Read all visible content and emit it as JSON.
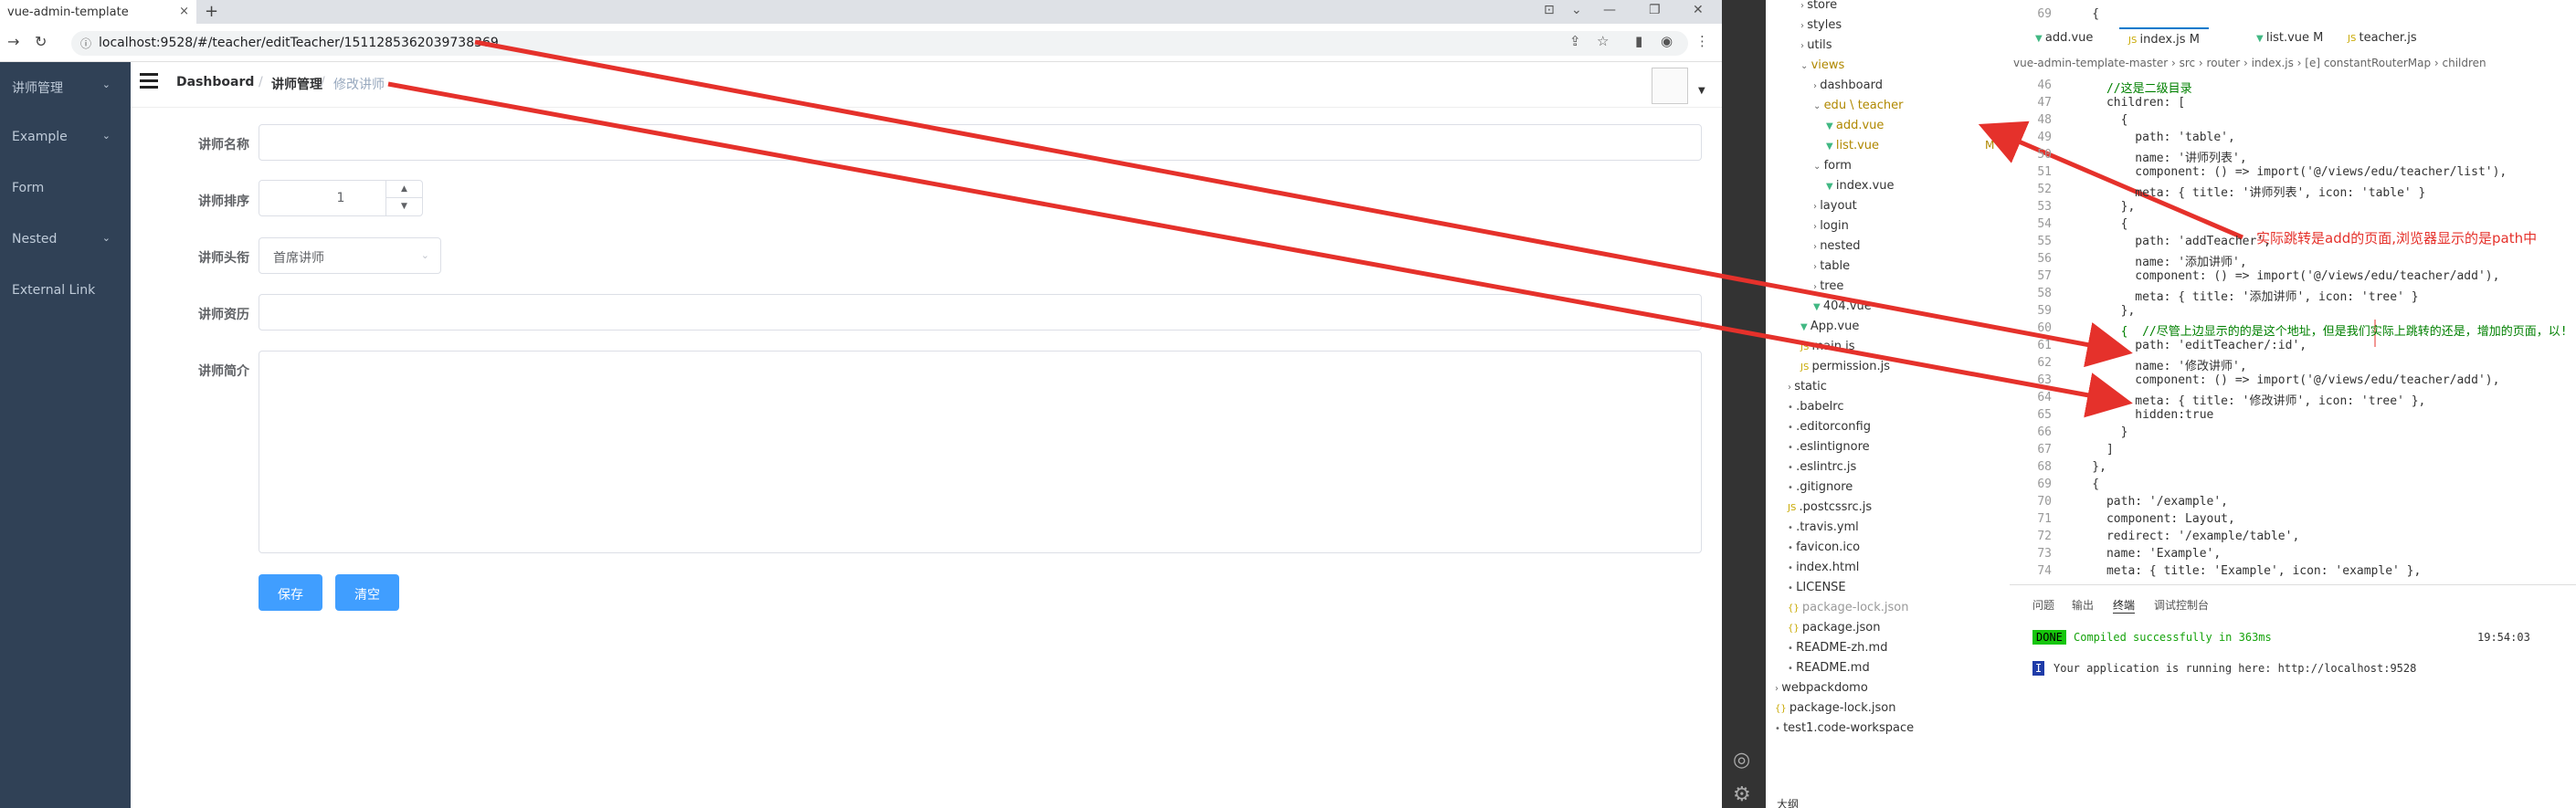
{
  "browser": {
    "tab_title": "vue-admin-template",
    "tab_close": "×",
    "new_tab": "+",
    "url": "localhost:9528/#/teacher/editTeacher/1511285362039738369",
    "window_min": "—",
    "window_max": "❐",
    "window_close": "✕"
  },
  "sidebar": {
    "items": [
      {
        "label": "讲师管理",
        "has_arrow": true
      },
      {
        "label": "Example",
        "has_arrow": true
      },
      {
        "label": "Form",
        "has_arrow": false
      },
      {
        "label": "Nested",
        "has_arrow": true
      },
      {
        "label": "External Link",
        "has_arrow": false
      }
    ],
    "bg_color": "#304156",
    "text_color": "#bfcbd9"
  },
  "breadcrumb": {
    "items": [
      "Dashboard",
      "讲师管理",
      "修改讲师"
    ],
    "separator": "/"
  },
  "form": {
    "labels": {
      "name": "讲师名称",
      "sort": "讲师排序",
      "level": "讲师头衔",
      "career": "讲师资历",
      "intro": "讲师简介"
    },
    "sort_value": "1",
    "level_value": "首席讲师",
    "save_label": "保存",
    "clear_label": "清空",
    "button_color": "#409eff"
  },
  "vscode": {
    "tree": [
      {
        "label": "store",
        "indent": 2,
        "type": "folder"
      },
      {
        "label": "styles",
        "indent": 2,
        "type": "folder"
      },
      {
        "label": "utils",
        "indent": 2,
        "type": "folder"
      },
      {
        "label": "views",
        "indent": 2,
        "type": "folder-open",
        "color": "#b08800"
      },
      {
        "label": "dashboard",
        "indent": 3,
        "type": "folder"
      },
      {
        "label": "edu \\ teacher",
        "indent": 3,
        "type": "folder-open",
        "color": "#b08800"
      },
      {
        "label": "add.vue",
        "indent": 4,
        "type": "vue",
        "color": "#b08800"
      },
      {
        "label": "list.vue",
        "indent": 4,
        "type": "vue",
        "color": "#b08800",
        "badge": "M"
      },
      {
        "label": "form",
        "indent": 3,
        "type": "folder-open"
      },
      {
        "label": "index.vue",
        "indent": 4,
        "type": "vue"
      },
      {
        "label": "layout",
        "indent": 3,
        "type": "folder"
      },
      {
        "label": "login",
        "indent": 3,
        "type": "folder"
      },
      {
        "label": "nested",
        "indent": 3,
        "type": "folder"
      },
      {
        "label": "table",
        "indent": 3,
        "type": "folder"
      },
      {
        "label": "tree",
        "indent": 3,
        "type": "folder"
      },
      {
        "label": "404.vue",
        "indent": 3,
        "type": "vue"
      },
      {
        "label": "App.vue",
        "indent": 2,
        "type": "vue"
      },
      {
        "label": "main.js",
        "indent": 2,
        "type": "js"
      },
      {
        "label": "permission.js",
        "indent": 2,
        "type": "js"
      },
      {
        "label": "static",
        "indent": 1,
        "type": "folder"
      },
      {
        "label": ".babelrc",
        "indent": 1,
        "type": "file"
      },
      {
        "label": ".editorconfig",
        "indent": 1,
        "type": "file"
      },
      {
        "label": ".eslintignore",
        "indent": 1,
        "type": "file"
      },
      {
        "label": ".eslintrc.js",
        "indent": 1,
        "type": "file"
      },
      {
        "label": ".gitignore",
        "indent": 1,
        "type": "file"
      },
      {
        "label": ".postcssrc.js",
        "indent": 1,
        "type": "js"
      },
      {
        "label": ".travis.yml",
        "indent": 1,
        "type": "file"
      },
      {
        "label": "favicon.ico",
        "indent": 1,
        "type": "file"
      },
      {
        "label": "index.html",
        "indent": 1,
        "type": "file"
      },
      {
        "label": "LICENSE",
        "indent": 1,
        "type": "file"
      },
      {
        "label": "package-lock.json",
        "indent": 1,
        "type": "json",
        "color": "#999"
      },
      {
        "label": "package.json",
        "indent": 1,
        "type": "json"
      },
      {
        "label": "README-zh.md",
        "indent": 1,
        "type": "file"
      },
      {
        "label": "README.md",
        "indent": 1,
        "type": "file"
      },
      {
        "label": "webpackdomo",
        "indent": 0,
        "type": "folder"
      },
      {
        "label": "package-lock.json",
        "indent": 0,
        "type": "json"
      },
      {
        "label": "test1.code-workspace",
        "indent": 0,
        "type": "file"
      }
    ],
    "tabs": [
      {
        "label": "add.vue",
        "badge": ""
      },
      {
        "label": "index.js",
        "badge": "M",
        "active": true
      },
      {
        "label": "list.vue",
        "badge": "M"
      },
      {
        "label": "teacher.js",
        "badge": ""
      }
    ],
    "breadcrumb": "vue-admin-template-master › src › router › index.js › [e] constantRouterMap › children",
    "code": [
      {
        "n": "46",
        "t": "      //这是二级目录"
      },
      {
        "n": "47",
        "t": "      children: ["
      },
      {
        "n": "48",
        "t": "        {"
      },
      {
        "n": "49",
        "t": "          path: 'table',"
      },
      {
        "n": "50",
        "t": "          name: '讲师列表',"
      },
      {
        "n": "51",
        "t": "          component: () => import('@/views/edu/teacher/list'),"
      },
      {
        "n": "52",
        "t": "          meta: { title: '讲师列表', icon: 'table' }"
      },
      {
        "n": "53",
        "t": "        },"
      },
      {
        "n": "54",
        "t": "        {"
      },
      {
        "n": "55",
        "t": "          path: 'addTeacher',"
      },
      {
        "n": "56",
        "t": "          name: '添加讲师',"
      },
      {
        "n": "57",
        "t": "          component: () => import('@/views/edu/teacher/add'),"
      },
      {
        "n": "58",
        "t": "          meta: { title: '添加讲师', icon: 'tree' }"
      },
      {
        "n": "59",
        "t": "        },"
      },
      {
        "n": "60",
        "t": "        {  //尽管上边显示的的是这个地址，但是我们实际上跳转的还是，增加的页面，以!"
      },
      {
        "n": "61",
        "t": "          path: 'editTeacher/:id',"
      },
      {
        "n": "62",
        "t": "          name: '修改讲师',"
      },
      {
        "n": "63",
        "t": "          component: () => import('@/views/edu/teacher/add'),"
      },
      {
        "n": "64",
        "t": "          meta: { title: '修改讲师', icon: 'tree' },"
      },
      {
        "n": "65",
        "t": "          hidden:true"
      },
      {
        "n": "66",
        "t": "        }"
      },
      {
        "n": "67",
        "t": "      ]"
      },
      {
        "n": "68",
        "t": "    },"
      },
      {
        "n": "69",
        "t": "    {"
      },
      {
        "n": "70",
        "t": "      path: '/example',"
      },
      {
        "n": "71",
        "t": "      component: Layout,"
      },
      {
        "n": "72",
        "t": "      redirect: '/example/table',"
      },
      {
        "n": "73",
        "t": "      name: 'Example',"
      },
      {
        "n": "74",
        "t": "      meta: { title: 'Example', icon: 'example' },"
      }
    ],
    "top_lines": [
      {
        "n": "69",
        "t": "    {"
      }
    ],
    "note": "实际跳转是add的页面,浏览器显示的是path中",
    "panel": {
      "tabs": [
        "问题",
        "输出",
        "终端",
        "调试控制台"
      ],
      "done_badge": "DONE",
      "compiled": "Compiled successfully in 363ms",
      "time": "19:54:03",
      "running": "Your application is running here: http://localhost:9528"
    },
    "status_label": "大纲"
  }
}
